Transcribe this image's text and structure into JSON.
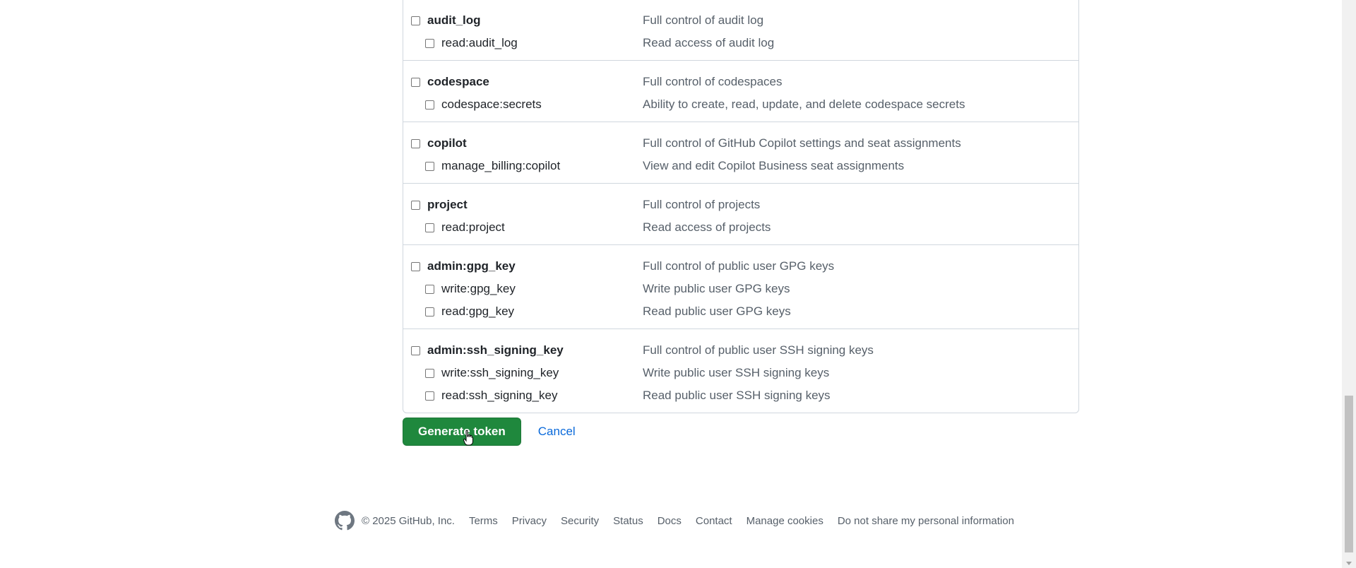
{
  "scopes": {
    "audit_log": {
      "parent": {
        "name": "audit_log",
        "desc": "Full control of audit log"
      },
      "children": [
        {
          "name": "read:audit_log",
          "desc": "Read access of audit log"
        }
      ]
    },
    "codespace": {
      "parent": {
        "name": "codespace",
        "desc": "Full control of codespaces"
      },
      "children": [
        {
          "name": "codespace:secrets",
          "desc": "Ability to create, read, update, and delete codespace secrets"
        }
      ]
    },
    "copilot": {
      "parent": {
        "name": "copilot",
        "desc": "Full control of GitHub Copilot settings and seat assignments"
      },
      "children": [
        {
          "name": "manage_billing:copilot",
          "desc": "View and edit Copilot Business seat assignments"
        }
      ]
    },
    "project": {
      "parent": {
        "name": "project",
        "desc": "Full control of projects"
      },
      "children": [
        {
          "name": "read:project",
          "desc": "Read access of projects"
        }
      ]
    },
    "gpg_key": {
      "parent": {
        "name": "admin:gpg_key",
        "desc": "Full control of public user GPG keys"
      },
      "children": [
        {
          "name": "write:gpg_key",
          "desc": "Write public user GPG keys"
        },
        {
          "name": "read:gpg_key",
          "desc": "Read public user GPG keys"
        }
      ]
    },
    "ssh_signing_key": {
      "parent": {
        "name": "admin:ssh_signing_key",
        "desc": "Full control of public user SSH signing keys"
      },
      "children": [
        {
          "name": "write:ssh_signing_key",
          "desc": "Write public user SSH signing keys"
        },
        {
          "name": "read:ssh_signing_key",
          "desc": "Read public user SSH signing keys"
        }
      ]
    }
  },
  "actions": {
    "generate_label": "Generate token",
    "cancel_label": "Cancel"
  },
  "footer": {
    "copyright": "© 2025 GitHub, Inc.",
    "links": [
      "Terms",
      "Privacy",
      "Security",
      "Status",
      "Docs",
      "Contact",
      "Manage cookies",
      "Do not share my personal information"
    ]
  },
  "colors": {
    "primary_button": "#1f883d",
    "link": "#0969da",
    "muted_text": "#57606a",
    "border": "#d0d7de"
  }
}
